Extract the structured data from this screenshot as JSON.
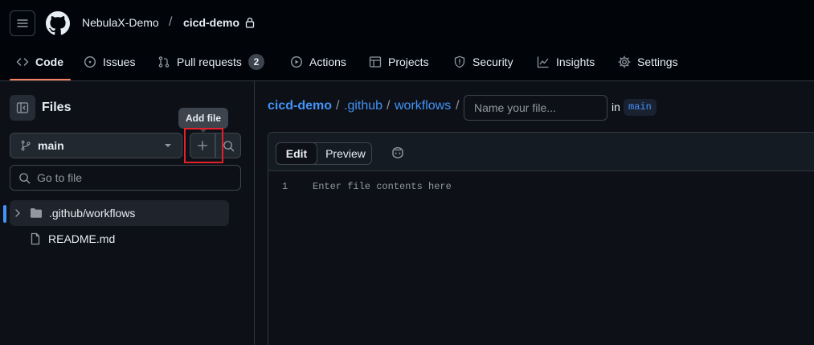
{
  "header": {
    "owner": "NebulaX-Demo",
    "separator": "/",
    "repo": "cicd-demo",
    "accent_color": "#f78166"
  },
  "tabs": [
    {
      "label": "Code",
      "icon": "code-icon",
      "active": true
    },
    {
      "label": "Issues",
      "icon": "issue-icon"
    },
    {
      "label": "Pull requests",
      "icon": "pull-request-icon",
      "count": "2"
    },
    {
      "label": "Actions",
      "icon": "play-icon"
    },
    {
      "label": "Projects",
      "icon": "table-icon"
    },
    {
      "label": "Security",
      "icon": "shield-icon"
    },
    {
      "label": "Insights",
      "icon": "graph-icon"
    },
    {
      "label": "Settings",
      "icon": "gear-icon"
    }
  ],
  "sidebar": {
    "title": "Files",
    "tooltip": "Add file",
    "branch": "main",
    "goto_placeholder": "Go to file",
    "tree": [
      {
        "name": ".github/workflows",
        "type": "folder",
        "selected": true
      },
      {
        "name": "README.md",
        "type": "file"
      }
    ]
  },
  "main": {
    "breadcrumb": [
      "cicd-demo",
      ".github",
      "workflows"
    ],
    "breadcrumb_separator": "/",
    "filename_placeholder": "Name your file...",
    "in_label": "in",
    "branch": "main",
    "editor": {
      "edit_label": "Edit",
      "preview_label": "Preview",
      "line_number": "1",
      "placeholder": "Enter file contents here"
    }
  }
}
